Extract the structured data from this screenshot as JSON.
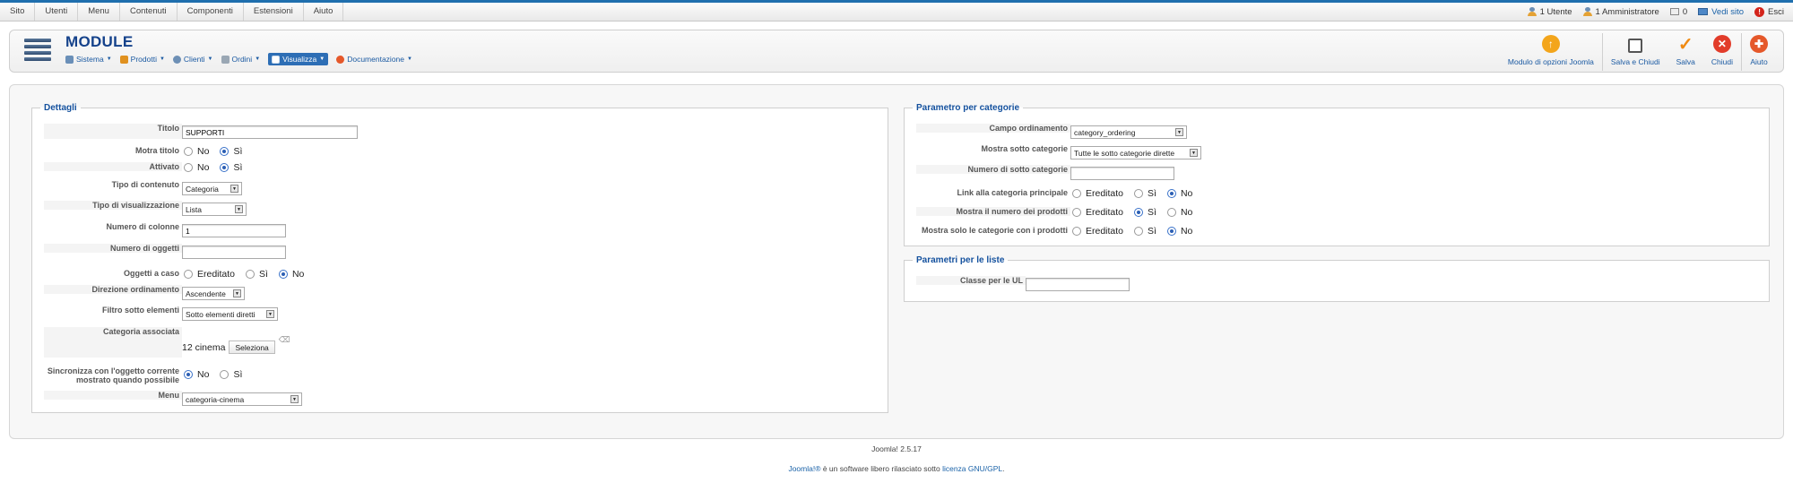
{
  "topmenu": [
    "Sito",
    "Utenti",
    "Menu",
    "Contenuti",
    "Componenti",
    "Estensioni",
    "Aiuto"
  ],
  "status": {
    "users": "1 Utente",
    "admins": "1 Amministratore",
    "messages": "0",
    "view_site": "Vedi sito",
    "logout": "Esci"
  },
  "header": {
    "title": "MODULE",
    "submenu": [
      {
        "label": "Sistema",
        "icon": "tools-icon",
        "color": "#6a8fb8"
      },
      {
        "label": "Prodotti",
        "icon": "box-icon",
        "color": "#e0911f"
      },
      {
        "label": "Clienti",
        "icon": "users-icon",
        "color": "#6d8fb5"
      },
      {
        "label": "Ordini",
        "icon": "cart-icon",
        "color": "#9aa7b4"
      },
      {
        "label": "Visualizza",
        "icon": "window-icon",
        "color": "#ffffff"
      },
      {
        "label": "Documentazione",
        "icon": "lifebuoy-icon",
        "color": "#e5582a"
      }
    ],
    "toolbar": {
      "options": "Modulo di opzioni Joomla",
      "save_close": "Salva e Chiudi",
      "save": "Salva",
      "close": "Chiudi",
      "help": "Aiuto"
    }
  },
  "details": {
    "legend": "Dettagli",
    "titolo_label": "Titolo",
    "titolo_value": "SUPPORTI",
    "mostra_titolo_label": "Motra titolo",
    "attivato_label": "Attivato",
    "no": "No",
    "si": "Sì",
    "ereditato": "Ereditato",
    "tipo_contenuto_label": "Tipo di contenuto",
    "tipo_contenuto_value": "Categoria",
    "tipo_visualizzazione_label": "Tipo di visualizzazione",
    "tipo_visualizzazione_value": "Lista",
    "numero_colonne_label": "Numero di colonne",
    "numero_colonne_value": "1",
    "numero_oggetti_label": "Numero di oggetti",
    "numero_oggetti_value": "",
    "oggetti_caso_label": "Oggetti a caso",
    "direzione_label": "Direzione ordinamento",
    "direzione_value": "Ascendente",
    "filtro_label": "Filtro sotto elementi",
    "filtro_value": "Sotto elementi diretti",
    "categoria_label": "Categoria associata",
    "categoria_value": "12 cinema",
    "seleziona": "Seleziona",
    "sincronizza_label_1": "Sincronizza con l'oggetto corrente",
    "sincronizza_label_2": "mostrato quando possibile",
    "menu_label": "Menu",
    "menu_value": "categoria-cinema"
  },
  "category_params": {
    "legend": "Parametro per categorie",
    "campo_label": "Campo ordinamento",
    "campo_value": "category_ordering",
    "mostra_sotto_label": "Mostra sotto categorie",
    "mostra_sotto_value": "Tutte le sotto categorie dirette",
    "numero_sotto_label": "Numero di sotto categorie",
    "numero_sotto_value": "",
    "link_label": "Link alla categoria principale",
    "mostra_numero_label": "Mostra il numero dei prodotti",
    "mostra_solo_label": "Mostra solo le categorie con i prodotti",
    "ereditato": "Ereditato",
    "si": "Sì",
    "no": "No"
  },
  "list_params": {
    "legend": "Parametri per le liste",
    "classe_label": "Classe per le UL",
    "classe_value": ""
  },
  "footer": {
    "version": "Joomla! 2.5.17",
    "joomla": "Joomla!®",
    "license_text": " è un software libero rilasciato sotto ",
    "license_link": "licenza GNU/GPL",
    "period": "."
  }
}
